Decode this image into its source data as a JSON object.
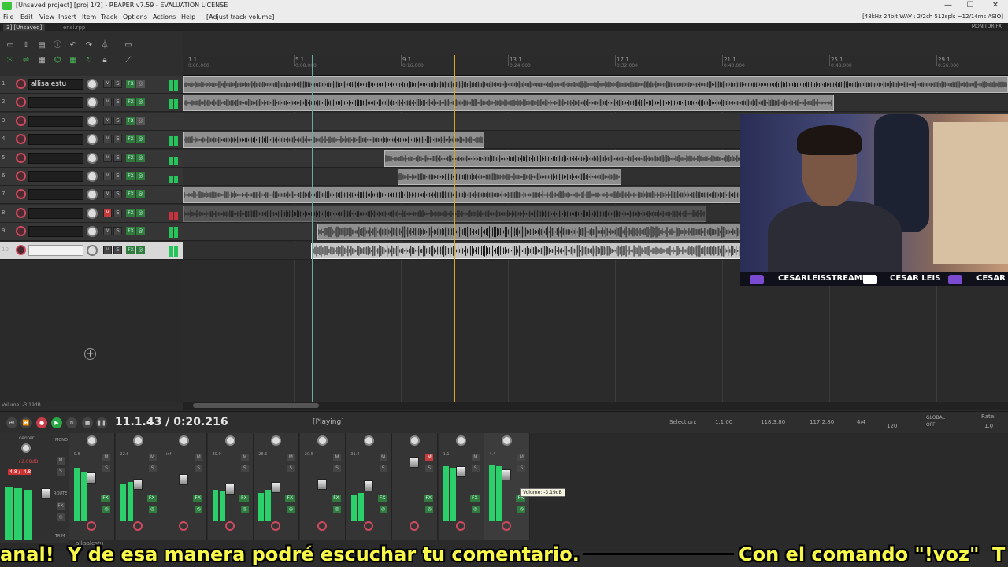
{
  "window": {
    "title": "[Unsaved project] [proj 1/2] - REAPER v7.59 - EVALUATION LICENSE",
    "minimize": "—",
    "maximize": "☐",
    "close": "✕"
  },
  "menu": {
    "items": [
      "File",
      "Edit",
      "View",
      "Insert",
      "Item",
      "Track",
      "Options",
      "Actions",
      "Help"
    ],
    "status": "[Adjust track volume]",
    "audio": "[48kHz 24bit WAV : 2/2ch 512spls ~12/14ms ASIO]"
  },
  "tabs": [
    "3] [Unsaved]",
    "ensi.rpp"
  ],
  "monitor_fx": "MONITOR FX",
  "toolbar_icons": [
    "new-project-icon",
    "open-project-icon",
    "save-icon",
    "properties-icon",
    "undo-icon",
    "redo-icon",
    "metronome-icon",
    "grid-icon",
    "snap-icon",
    "ripple-icon",
    "envelope-icon",
    "loop-icon",
    "lock-icon"
  ],
  "tracks": [
    {
      "num": "1",
      "name": "allisalestu",
      "mute": false,
      "io_active": false
    },
    {
      "num": "2",
      "name": "",
      "mute": false,
      "io_active": true
    },
    {
      "num": "3",
      "name": "",
      "mute": false,
      "io_active": false
    },
    {
      "num": "4",
      "name": "",
      "mute": false,
      "io_active": true
    },
    {
      "num": "5",
      "name": "",
      "mute": false,
      "io_active": true
    },
    {
      "num": "6",
      "name": "",
      "mute": false,
      "io_active": true
    },
    {
      "num": "7",
      "name": "",
      "mute": false,
      "io_active": true
    },
    {
      "num": "8",
      "name": "",
      "mute": true,
      "io_active": true
    },
    {
      "num": "9",
      "name": "",
      "mute": false,
      "io_active": true
    },
    {
      "num": "10",
      "name": "",
      "mute": false,
      "io_active": true
    }
  ],
  "track_buttons": {
    "mute": "M",
    "solo": "S",
    "fx": "FX",
    "io": "◎"
  },
  "ruler": [
    {
      "bar": "1.1",
      "time": "0:00.000"
    },
    {
      "bar": "5.1",
      "time": "0:08.000"
    },
    {
      "bar": "9.1",
      "time": "0:16.000"
    },
    {
      "bar": "13.1",
      "time": "0:24.000"
    },
    {
      "bar": "17.1",
      "time": "0:32.000"
    },
    {
      "bar": "21.1",
      "time": "0:40.000"
    },
    {
      "bar": "25.1",
      "time": "0:48.000"
    },
    {
      "bar": "29.1",
      "time": "0:56.000"
    }
  ],
  "volume_status": "Volume: -3.19dB",
  "transport": {
    "time": "11.1.43 / 0:20.216",
    "state": "[Playing]",
    "selection_label": "Selection:",
    "sel_start": "1.1.00",
    "sel_end": "118.3.80",
    "sel_len": "117.2.80",
    "timesig": "4/4",
    "bpm": "120",
    "global": "GLOBAL",
    "global_state": "OFF",
    "rate_label": "Rate:",
    "rate": "1.0"
  },
  "mixer": {
    "master_label": "center",
    "master_db": "+2.08dB",
    "master_peak": "-4.8 / -4.8",
    "master_buttons": [
      "MONO",
      "M",
      "S",
      "ROUTE",
      "FX",
      "◎",
      "TRIM"
    ],
    "strip_db": [
      "-9.8",
      "-22.6",
      "-inf",
      "-39.9",
      "-28.6",
      "-20.5",
      "-31.4",
      "",
      "-1.1",
      "-4.4"
    ],
    "mute_on": [
      false,
      false,
      false,
      false,
      false,
      false,
      false,
      true,
      false,
      false
    ],
    "first_strip_name": "allisalestu",
    "tooltip": "Volume: -3.19dB"
  },
  "webcam": {
    "handles": [
      "CESARLEISSTREAMER",
      "CESAR LEIS",
      "CESAR LE"
    ]
  },
  "subtitle": {
    "part1": "anal!",
    "part2": "Y de esa manera podré escuchar tu comentario.",
    "part3": "Con el comando \"!voz\"",
    "part4": "T"
  }
}
